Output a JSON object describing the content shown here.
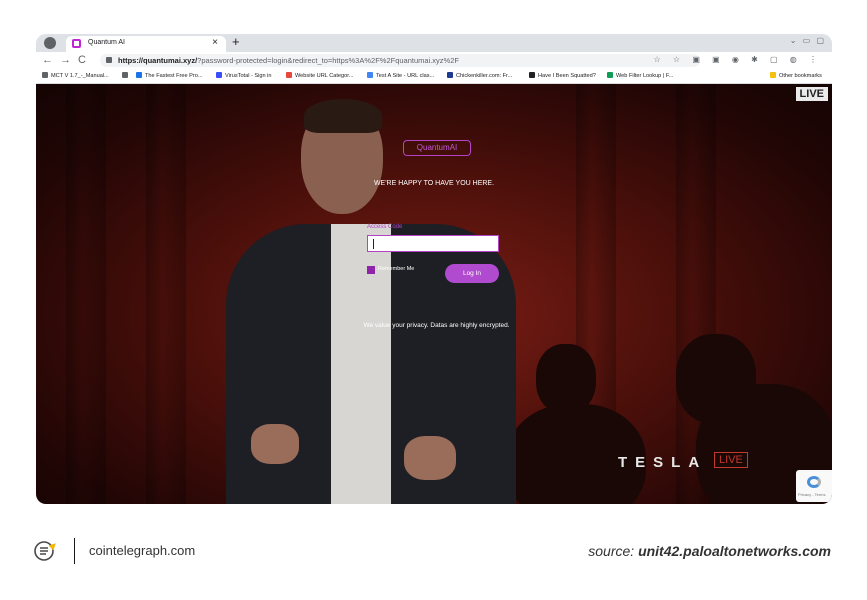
{
  "browser": {
    "tab_title": "Quantum AI",
    "tab_close": "×",
    "new_tab": "+",
    "window_controls": "⌄ ▭ ▢",
    "nav_back": "←",
    "nav_forward": "→",
    "nav_reload": "C",
    "url_domain": "https://quantumai.xyz/",
    "url_path": "?password-protected=login&redirect_to=https%3A%2F%2Fquantumai.xyz%2F",
    "toolbar_icons": "☆ ☆ ▣ ▣ ◉ ✱ ▢ ◍ ⋮"
  },
  "bookmarks": [
    {
      "label": "MCT V 1.7_-_Manual...",
      "color": "#5f6368"
    },
    {
      "label": "The Fastest Free Pro...",
      "color": "#1a73e8"
    },
    {
      "label": "VirusTotal - Sign in",
      "color": "#394eff"
    },
    {
      "label": "Website URL Categor...",
      "color": "#e8453c"
    },
    {
      "label": "Test A Site - URL clas...",
      "color": "#4285f4"
    },
    {
      "label": "Chickenkiller.com: Fr...",
      "color": "#1f3a93"
    },
    {
      "label": "Have I Been Squatted?",
      "color": "#202124"
    },
    {
      "label": "Web Filter Lookup | F...",
      "color": "#0f9d58"
    },
    {
      "label": "Other bookmarks",
      "color": "#f4c20d"
    }
  ],
  "video": {
    "live_badge": "LIVE",
    "tesla_text": "TESLA",
    "tesla_live": "LIVE",
    "recaptcha_text": "Privacy - Terms"
  },
  "page": {
    "logo_text": "QuantumAI",
    "welcome": "WE'RE HAPPY TO HAVE YOU HERE.",
    "access_label": "Access Code",
    "remember_label": "Remember Me",
    "login_button": "Log In",
    "privacy_note": "We value your privacy. Datas are highly encrypted.",
    "accent_color": "#b04bd0"
  },
  "footer": {
    "site": "cointelegraph.com",
    "source_prefix": "source: ",
    "source_domain": "unit42.paloaltonetworks.com"
  }
}
